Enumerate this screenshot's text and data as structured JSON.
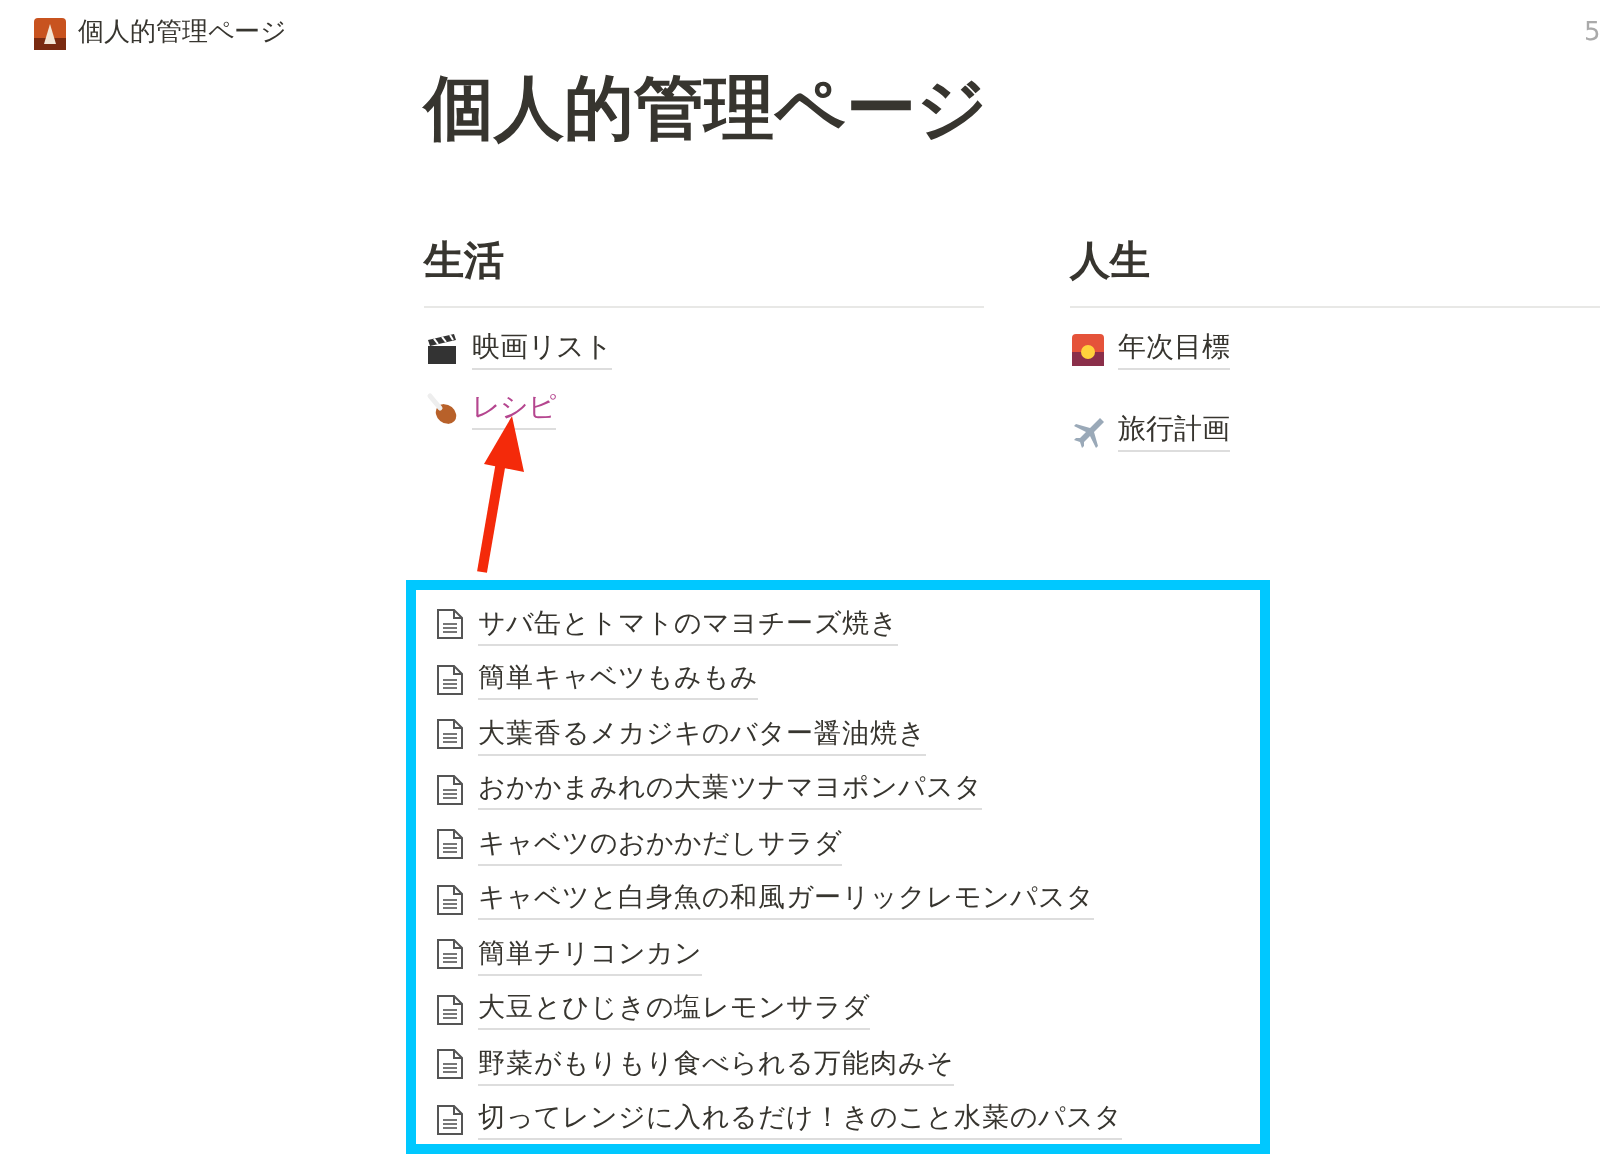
{
  "topbar": {
    "breadcrumb": "個人的管理ページ",
    "time": "5"
  },
  "title": "個人的管理ページ",
  "columns": [
    {
      "heading": "生活",
      "items": [
        {
          "label": "映画リスト",
          "highlighted": false
        },
        {
          "label": "レシピ",
          "highlighted": true
        }
      ]
    },
    {
      "heading": "人生",
      "items": [
        {
          "label": "年次目標",
          "highlighted": false
        },
        {
          "label": "旅行計画",
          "highlighted": false
        }
      ]
    }
  ],
  "recipes": [
    "サバ缶とトマトのマヨチーズ焼き",
    "簡単キャベツもみもみ",
    "大葉香るメカジキのバター醤油焼き",
    "おかかまみれの大葉ツナマヨポンパスタ",
    "キャベツのおかかだしサラダ",
    "キャベツと白身魚の和風ガーリックレモンパスタ",
    "簡単チリコンカン",
    "大豆とひじきの塩レモンサラダ",
    "野菜がもりもり食べられる万能肉みそ",
    "切ってレンジに入れるだけ！きのこと水菜のパスタ"
  ]
}
